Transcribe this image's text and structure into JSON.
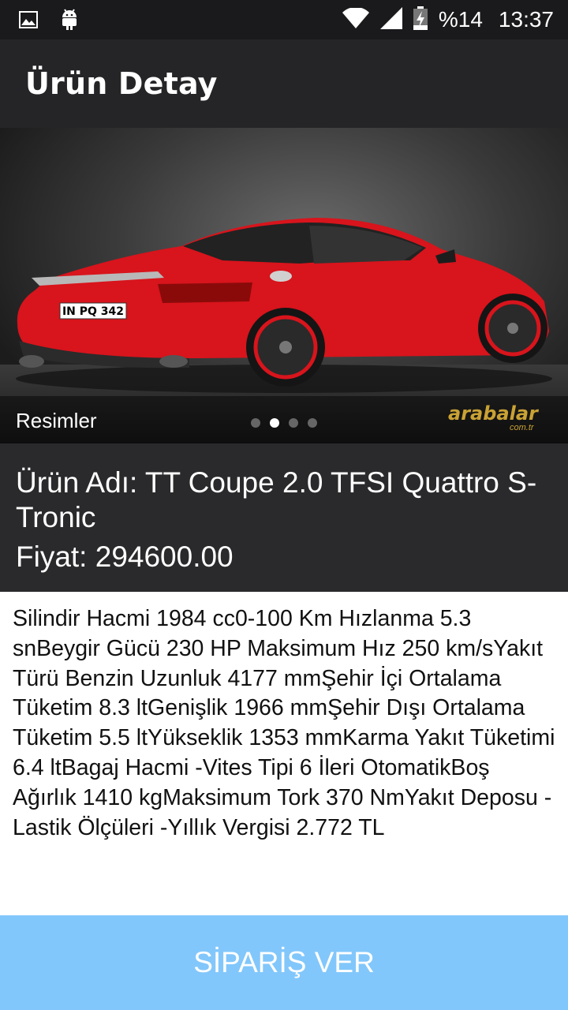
{
  "status_bar": {
    "battery": "%14",
    "time": "13:37",
    "icons": [
      "image-icon",
      "android-icon",
      "wifi-icon",
      "signal-icon",
      "battery-charging-icon"
    ]
  },
  "toolbar": {
    "title": "Ürün Detay"
  },
  "carousel": {
    "label": "Resimler",
    "page_count": 4,
    "active_index": 1,
    "watermark": "arabalar",
    "watermark_sub": "com.tr",
    "plate": "IN PQ 342"
  },
  "product": {
    "name": "Ürün Adı: TT Coupe 2.0 TFSI Quattro S-Tronic",
    "price": "Fiyat: 294600.00",
    "description": "Silindir Hacmi 1984 cc0-100 Km Hızlanma 5.3 snBeygir Gücü 230 HP Maksimum Hız 250 km/sYakıt Türü Benzin Uzunluk 4177 mmŞehir İçi Ortalama Tüketim 8.3 ltGenişlik 1966 mmŞehir Dışı Ortalama Tüketim 5.5 ltYükseklik 1353 mmKarma Yakıt Tüketimi 6.4 ltBagaj Hacmi -Vites Tipi 6 İleri OtomatikBoş Ağırlık 1410 kgMaksimum Tork 370 NmYakıt Deposu -Lastik Ölçüleri -Yıllık Vergisi 2.772 TL"
  },
  "order_button": {
    "label": "SİPARİŞ VER"
  },
  "colors": {
    "status_bar": "#1a1a1c",
    "toolbar": "#252527",
    "info_bg": "#2a2a2c",
    "button": "#82c7fb",
    "car": "#d8141c"
  }
}
